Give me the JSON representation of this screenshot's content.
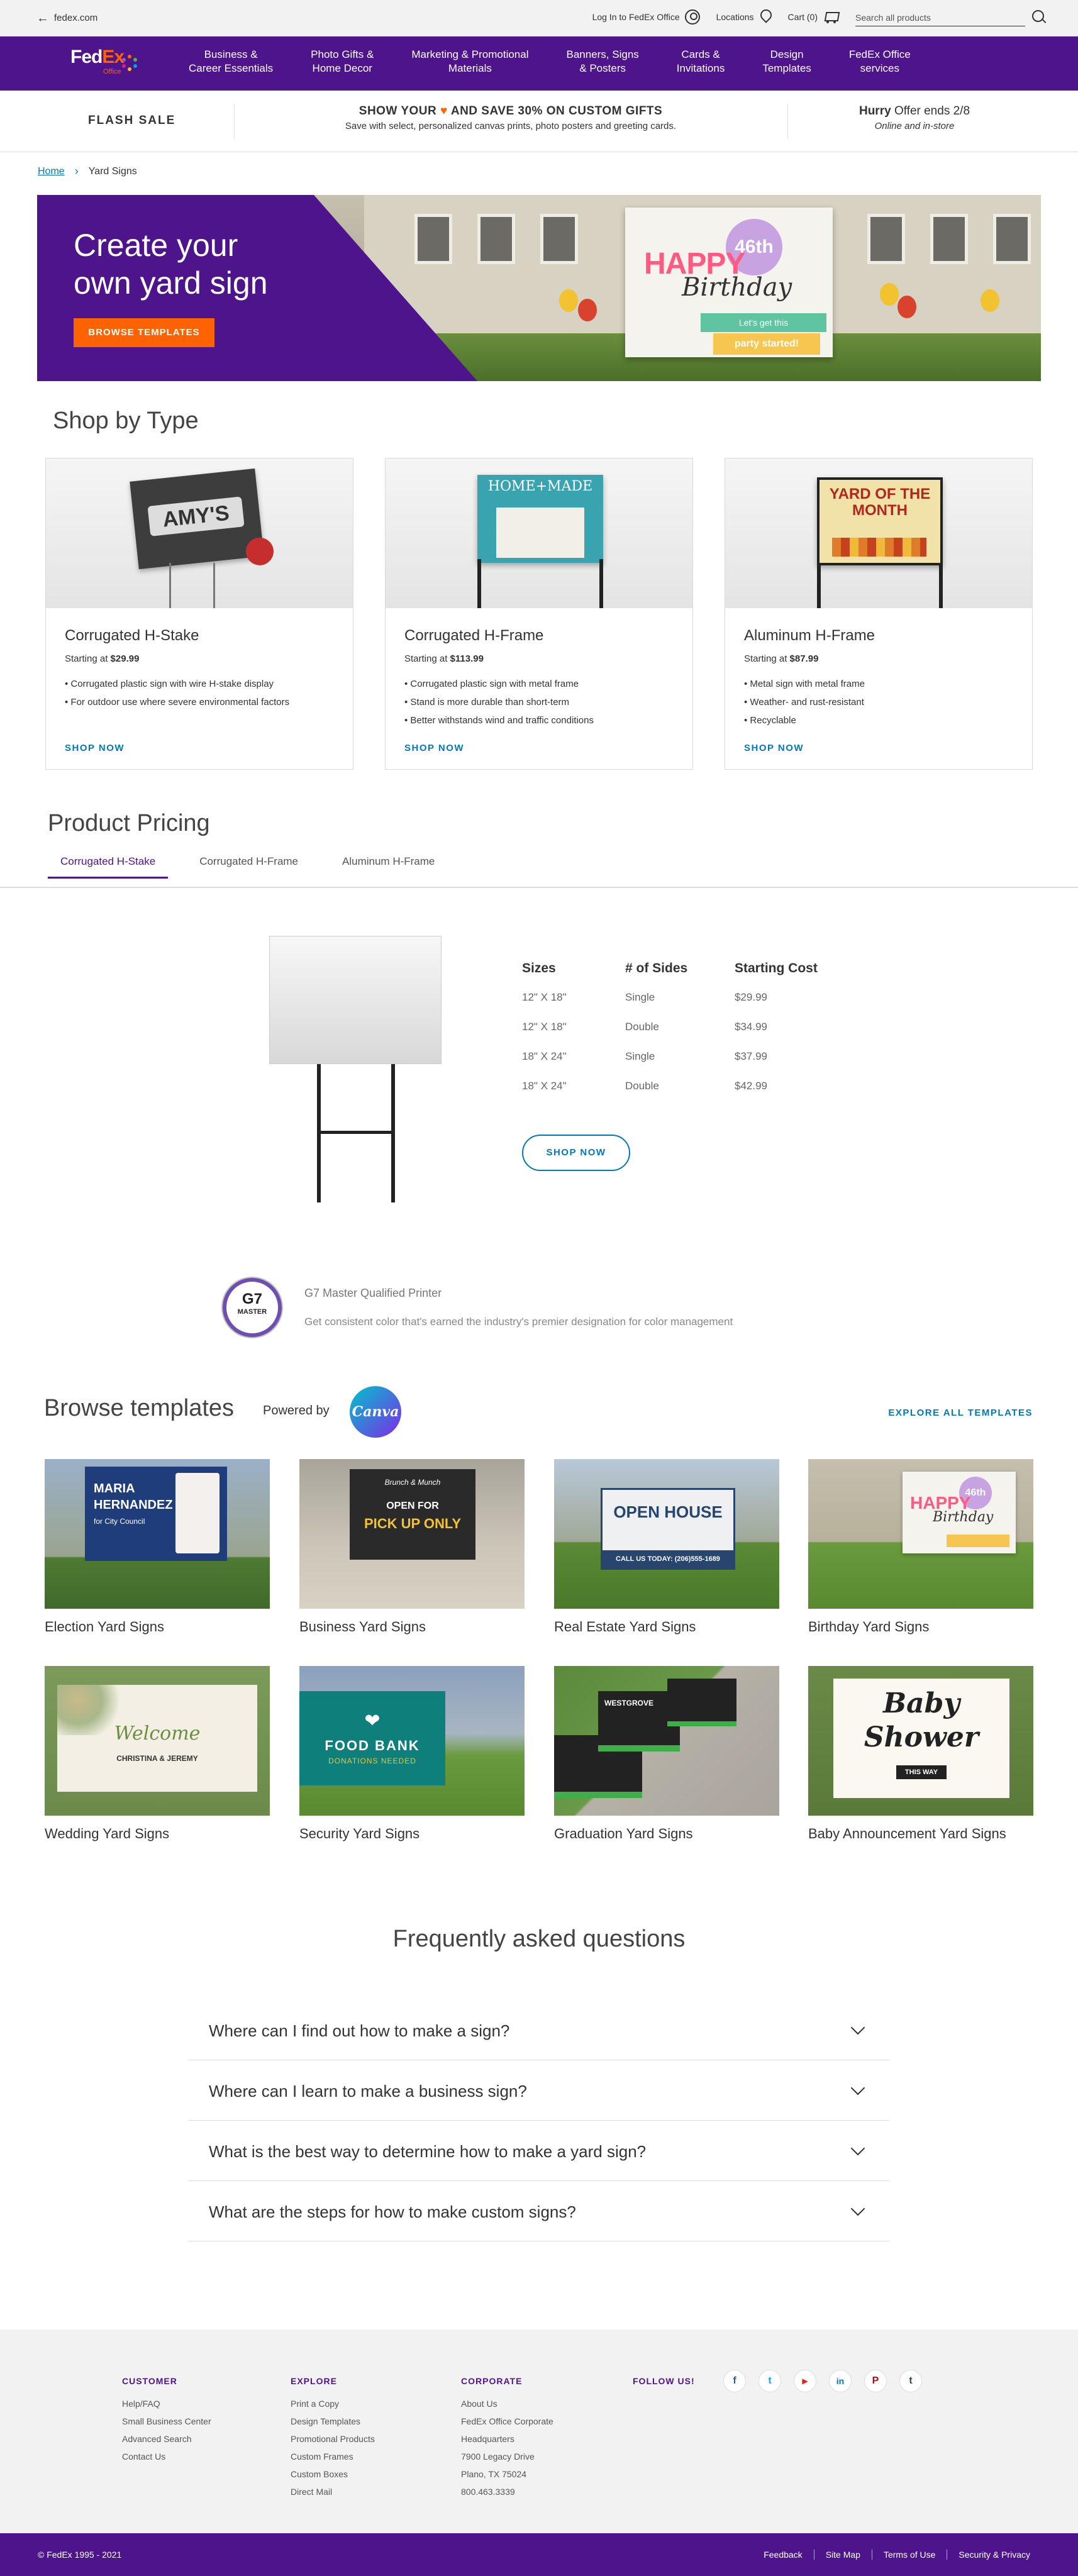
{
  "util": {
    "back_label": "fedex.com",
    "login": "Log In to FedEx Office",
    "locations": "Locations",
    "cart": "Cart (0)",
    "search_placeholder": "Search all products"
  },
  "nav": {
    "logo_fed": "Fed",
    "logo_ex": "Ex",
    "logo_office": "Office",
    "items": [
      "Business &\nCareer Essentials",
      "Photo Gifts &\nHome Decor",
      "Marketing & Promotional\nMaterials",
      "Banners, Signs\n& Posters",
      "Cards &\nInvitations",
      "Design\nTemplates",
      "FedEx Office\nservices"
    ]
  },
  "flash": {
    "label": "FLASH SALE",
    "headline_pre": "SHOW YOUR",
    "headline_post": "AND SAVE 30% ON CUSTOM GIFTS",
    "sub": "Save with select, personalized canvas prints, photo posters and greeting cards.",
    "hurry_bold": "Hurry",
    "hurry_rest": " Offer ends 2/8",
    "hurry_sub": "Online and in-store"
  },
  "breadcrumb": {
    "home": "Home",
    "current": "Yard Signs"
  },
  "hero": {
    "title": "Create your\nown yard sign",
    "button": "BROWSE TEMPLATES",
    "sign_happy": "HAPPY",
    "sign_age": "46th",
    "sign_birthday": "Birthday",
    "sign_band1": "Let's get this",
    "sign_band2": "party started!"
  },
  "shop_by_type": {
    "heading": "Shop by Type",
    "cards": [
      {
        "title": "Corrugated H-Stake",
        "price_prefix": "Starting at ",
        "price": "$29.99",
        "bullets": [
          "Corrugated plastic sign with wire H-stake display",
          "For outdoor use where severe environmental factors"
        ],
        "link": "SHOP NOW",
        "sign_text": "AMY'S"
      },
      {
        "title": "Corrugated H-Frame",
        "price_prefix": "Starting at ",
        "price": "$113.99",
        "bullets": [
          "Corrugated plastic sign with metal frame",
          "Stand is more durable than short-term",
          "Better withstands wind and traffic conditions"
        ],
        "link": "SHOP NOW",
        "sign_text": "HOME+MADE"
      },
      {
        "title": "Aluminum H-Frame",
        "price_prefix": "Starting at ",
        "price": "$87.99",
        "bullets": [
          "Metal sign with metal frame",
          "Weather- and rust-resistant",
          "Recyclable"
        ],
        "link": "SHOP NOW",
        "sign_text": "YARD OF THE MONTH"
      }
    ]
  },
  "pricing": {
    "heading": "Product Pricing",
    "tabs": [
      "Corrugated H-Stake",
      "Corrugated H-Frame",
      "Aluminum H-Frame"
    ],
    "columns": [
      "Sizes",
      "# of Sides",
      "Starting Cost"
    ],
    "rows": [
      [
        "12\" X 18\"",
        "Single",
        "$29.99"
      ],
      [
        "12\" X 18\"",
        "Double",
        "$34.99"
      ],
      [
        "18\" X 24\"",
        "Single",
        "$37.99"
      ],
      [
        "18\" X 24\"",
        "Double",
        "$42.99"
      ]
    ],
    "button": "SHOP NOW"
  },
  "g7": {
    "badge_top": "G7",
    "badge_bottom": "MASTER",
    "title": "G7 Master Qualified Printer",
    "desc": "Get consistent color that's earned the industry's premier designation for color management"
  },
  "templates": {
    "heading": "Browse templates",
    "powered_by": "Powered by",
    "canva": "Canva",
    "explore": "EXPLORE ALL TEMPLATES",
    "items": [
      "Election Yard Signs",
      "Business Yard Signs",
      "Real Estate Yard Signs",
      "Birthday Yard Signs",
      "Wedding Yard Signs",
      "Security Yard Signs",
      "Graduation Yard Signs",
      "Baby Announcement Yard Signs"
    ],
    "election": {
      "name1": "MARIA",
      "name2": "HERNANDEZ",
      "sub": "for City Council"
    },
    "business": {
      "top": "Brunch & Munch",
      "line1": "OPEN FOR",
      "line2": "PICK UP ONLY"
    },
    "realestate": {
      "line1": "OPEN HOUSE",
      "line2": "CALL US TODAY: (206)555-1689"
    },
    "wedding": {
      "line1": "Welcome",
      "line2": "CHRISTINA & JEREMY"
    },
    "security": {
      "line1": "FOOD BANK",
      "line2": "DONATIONS NEEDED"
    },
    "graduation": {
      "line1": "WESTGROVE"
    },
    "baby": {
      "line1": "Baby",
      "line2": "Shower",
      "line3": "THIS WAY"
    }
  },
  "faq": {
    "heading": "Frequently asked questions",
    "items": [
      "Where can I find out how to make a sign?",
      "Where can I learn to make a business sign?",
      "What is the best way to determine how to make a yard sign?",
      "What are the steps for how to make custom signs?"
    ]
  },
  "footer": {
    "customer": {
      "title": "CUSTOMER",
      "links": [
        "Help/FAQ",
        "Small Business Center",
        "Advanced Search",
        "Contact Us"
      ]
    },
    "explore": {
      "title": "EXPLORE",
      "links": [
        "Print a Copy",
        "Design Templates",
        "Promotional Products",
        "Custom Frames",
        "Custom Boxes",
        "Direct Mail"
      ]
    },
    "corporate": {
      "title": "CORPORATE",
      "links": [
        "About Us",
        "FedEx Office Corporate",
        "Headquarters",
        "7900 Legacy Drive",
        "Plano, TX 75024",
        "800.463.3339"
      ]
    },
    "follow": "FOLLOW US!",
    "social_glyphs": [
      "f",
      "t",
      "▶",
      "in",
      "P",
      "t"
    ],
    "copyright": "© FedEx 1995 - 2021",
    "bottom_links": [
      "Feedback",
      "Site Map",
      "Terms of Use",
      "Security & Privacy"
    ]
  },
  "colors": {
    "brand_purple": "#4d148c",
    "brand_orange": "#ff6200",
    "link_blue": "#007ab7"
  }
}
